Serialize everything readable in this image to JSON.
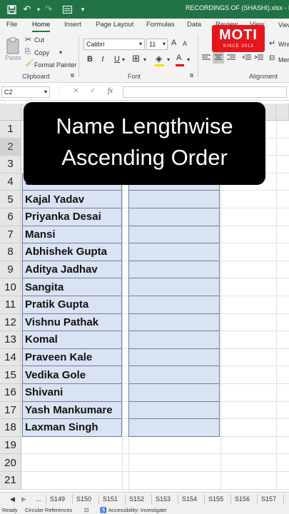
{
  "titlebar": {
    "title": "RECORDINGS OF (SHASHI).xlsx  -  Exce",
    "icons": [
      "save-icon",
      "undo-icon",
      "redo-icon",
      "form-icon",
      "customize-icon"
    ]
  },
  "tabs": [
    "File",
    "Home",
    "Insert",
    "Page Layout",
    "Formulas",
    "Data",
    "Review",
    "View"
  ],
  "active_tab": "Home",
  "clipboard": {
    "paste": "Paste",
    "cut": "Cut",
    "copy": "Copy",
    "format_painter": "Format Painter",
    "label": "Clipboard"
  },
  "font": {
    "name": "Calibri",
    "size": "11",
    "grow": "A",
    "shrink": "A",
    "bold": "B",
    "italic": "I",
    "underline": "U",
    "font_color": "A",
    "label": "Font"
  },
  "alignment": {
    "wrap": "Wra",
    "merge": "Mer",
    "label": "Alignment"
  },
  "logo": {
    "text": "MOTI",
    "sub": "SINCE 2013",
    "color": "#e3171c"
  },
  "formula_bar": {
    "name_box": "C2",
    "cancel": "✕",
    "enter": "✓",
    "fx": "fx",
    "value": ""
  },
  "overlay": {
    "line1": "Name Lengthwise",
    "line2": "Ascending Order"
  },
  "rows": [
    "1",
    "2",
    "3",
    "4",
    "5",
    "6",
    "7",
    "8",
    "9",
    "10",
    "11",
    "12",
    "13",
    "14",
    "15",
    "16",
    "17",
    "18",
    "19",
    "20",
    "21"
  ],
  "selected_row": "2",
  "names": [
    {
      "row": "4",
      "name": "Suman"
    },
    {
      "row": "5",
      "name": "Kajal Yadav"
    },
    {
      "row": "6",
      "name": "Priyanka Desai"
    },
    {
      "row": "7",
      "name": "Mansi"
    },
    {
      "row": "8",
      "name": "Abhishek Gupta"
    },
    {
      "row": "9",
      "name": "Aditya Jadhav"
    },
    {
      "row": "10",
      "name": "Sangita"
    },
    {
      "row": "11",
      "name": "Pratik Gupta"
    },
    {
      "row": "12",
      "name": "Vishnu Pathak"
    },
    {
      "row": "13",
      "name": "Komal"
    },
    {
      "row": "14",
      "name": "Praveen Kale"
    },
    {
      "row": "15",
      "name": "Vedika Gole"
    },
    {
      "row": "16",
      "name": "Shivani"
    },
    {
      "row": "17",
      "name": "Yash Mankumare"
    },
    {
      "row": "18",
      "name": "Laxman Singh"
    }
  ],
  "sheet_tabs": [
    "...",
    "S149",
    "S150",
    "S151",
    "S152",
    "S153",
    "S154",
    "S155",
    "S156",
    "S157"
  ],
  "status": {
    "ready": "Ready",
    "circular": "Circular References",
    "accessibility": "Accessibility: Investigate"
  },
  "colors": {
    "accent": "#217346",
    "cell_fill": "#dae3f3"
  }
}
